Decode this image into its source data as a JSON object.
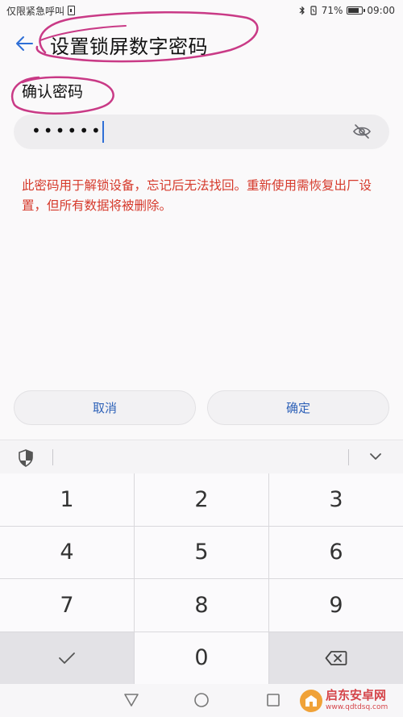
{
  "status_bar": {
    "left_text": "仅限紧急呼叫",
    "battery_percent": "71%",
    "battery_level": 0.71,
    "time": "09:00"
  },
  "header": {
    "title": "设置锁屏数字密码",
    "back_icon": "arrow-left-icon"
  },
  "password_field": {
    "label": "确认密码",
    "value_masked": "••••••",
    "visibility_icon": "eye-off-icon"
  },
  "warning_text": "此密码用于解锁设备，忘记后无法找回。重新使用需恢复出厂设置，但所有数据将被删除。",
  "buttons": {
    "cancel": "取消",
    "confirm": "确定"
  },
  "keyboard": {
    "toolbar_left_icon": "shield-icon",
    "toolbar_right_icon": "chevron-down-icon",
    "keys": [
      "1",
      "2",
      "3",
      "4",
      "5",
      "6",
      "7",
      "8",
      "9",
      "",
      "0",
      ""
    ],
    "done_icon": "checkmark-icon",
    "delete_icon": "backspace-icon"
  },
  "nav_bar": {
    "icons": [
      "triangle-back-icon",
      "circle-home-icon",
      "square-recent-icon"
    ]
  },
  "watermark": {
    "name": "启东安卓网",
    "url": "www.qdtdsq.com"
  },
  "colors": {
    "accent": "#2f62b8",
    "warning": "#d63a2c",
    "annotation": "#c93a86"
  }
}
